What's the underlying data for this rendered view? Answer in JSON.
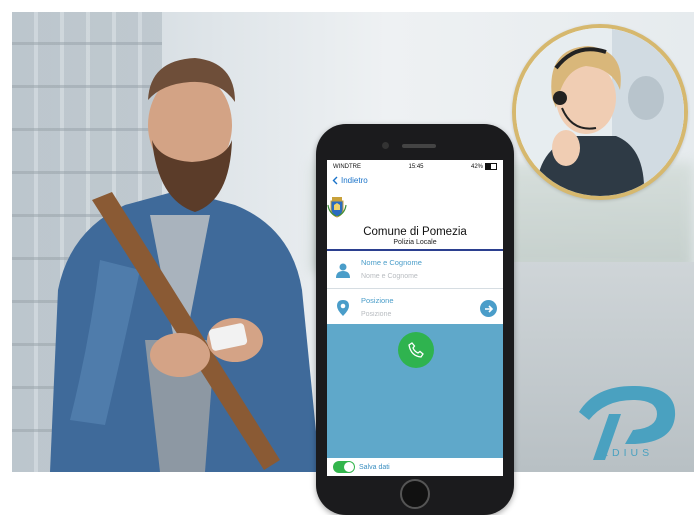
{
  "phone": {
    "status": {
      "carrier": "WINDTRE",
      "time": "15:45",
      "battery": "42%"
    },
    "nav": {
      "back_label": "Indietro"
    },
    "header": {
      "title": "Comune di Pomezia",
      "subtitle": "Polizia Locale"
    },
    "fields": [
      {
        "label": "Nome e Cognome",
        "placeholder": "Nome e Cognome",
        "icon": "person-icon"
      },
      {
        "label": "Posizione",
        "placeholder": "Posizione",
        "icon": "location-pin-icon"
      }
    ],
    "call_icon": "phone-icon",
    "footer": {
      "toggle_label": "Salva dati",
      "toggle_on": true
    }
  },
  "logo": {
    "text": "EDIUS"
  },
  "colors": {
    "accent": "#4a9dc9",
    "call_green": "#2fb34f",
    "rule_blue": "#2b3f8f",
    "panel": "#5fa8ca",
    "gold": "#d6b86e"
  }
}
